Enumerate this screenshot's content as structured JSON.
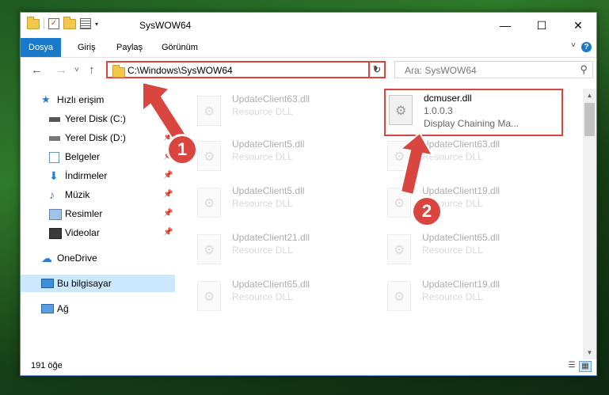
{
  "window": {
    "title": "SysWOW64",
    "controls": {
      "minimize": "—",
      "maximize": "☐",
      "close": "✕"
    }
  },
  "ribbon": {
    "tabs": [
      {
        "label": "Dosya",
        "active": true
      },
      {
        "label": "Giriş"
      },
      {
        "label": "Paylaş"
      },
      {
        "label": "Görünüm"
      }
    ],
    "help": "?"
  },
  "nav": {
    "back": "←",
    "forward": "→",
    "recent": "˅",
    "up": "↑",
    "address": "C:\\Windows\\SysWOW64",
    "refresh": "↻",
    "search_placeholder": "Ara: SysWOW64"
  },
  "sidebar": {
    "items": [
      {
        "label": "Hızlı erişim",
        "icon": "star-icon"
      },
      {
        "label": "Yerel Disk (C:)",
        "icon": "drive-icon",
        "pinned": true
      },
      {
        "label": "Yerel Disk (D:)",
        "icon": "drive-icon",
        "pinned": true
      },
      {
        "label": "Belgeler",
        "icon": "documents-icon",
        "pinned": true
      },
      {
        "label": "İndirmeler",
        "icon": "download-icon",
        "pinned": true
      },
      {
        "label": "Müzik",
        "icon": "music-icon",
        "pinned": true
      },
      {
        "label": "Resimler",
        "icon": "pictures-icon",
        "pinned": true
      },
      {
        "label": "Videolar",
        "icon": "videos-icon",
        "pinned": true
      },
      {
        "label": "OneDrive",
        "icon": "cloud-icon"
      },
      {
        "label": "Bu bilgisayar",
        "icon": "computer-icon",
        "selected": true
      },
      {
        "label": "Ağ",
        "icon": "network-icon"
      }
    ]
  },
  "files": [
    {
      "name": "UpdateClient63.dll",
      "desc": "Resource DLL",
      "faded": true
    },
    {
      "name": "dcmuser.dll",
      "version": "1.0.0.3",
      "desc": "Display Chaining Ma...",
      "highlighted": true
    },
    {
      "name": "UpdateClient5.dll",
      "desc": "Resource DLL",
      "faded": true
    },
    {
      "name": "UpdateClient63.dll",
      "desc": "Resource DLL",
      "faded": true
    },
    {
      "name": "UpdateClient5.dll",
      "desc": "Resource DLL",
      "faded": true
    },
    {
      "name": "UpdateClient19.dll",
      "desc": "Resource DLL",
      "faded": true
    },
    {
      "name": "UpdateClient21.dll",
      "desc": "Resource DLL",
      "faded": true
    },
    {
      "name": "UpdateClient65.dll",
      "desc": "Resource DLL",
      "faded": true
    },
    {
      "name": "UpdateClient65.dll",
      "desc": "Resource DLL",
      "faded": true
    },
    {
      "name": "UpdateClient19.dll",
      "desc": "Resource DLL",
      "faded": true
    }
  ],
  "status": {
    "count": "191 öğe"
  },
  "annotations": {
    "badge1": "1",
    "badge2": "2",
    "color": "#d9463f"
  }
}
